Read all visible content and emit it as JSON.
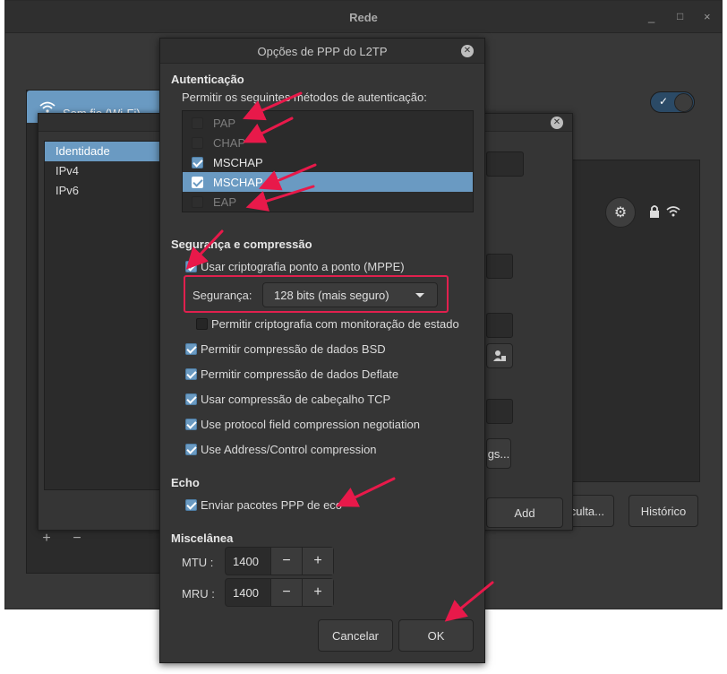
{
  "background_window": {
    "title": "Rede",
    "minimize": "_",
    "close": "×",
    "wifi_item": "Sem fio (Wi-Fi)",
    "hidden_network_button": "r a uma rede oculta...",
    "history_button": "Histórico"
  },
  "editor": {
    "sidebar_items": [
      "Identidade",
      "IPv4",
      "IPv6"
    ],
    "add_button": "Add",
    "settings_button": "gs...",
    "plus": "+",
    "minus": "−"
  },
  "dialog": {
    "title": "Opções de PPP do L2TP",
    "authentication": {
      "heading": "Autenticação",
      "description": "Permitir os seguintes métodos de autenticação:",
      "methods": [
        {
          "label": "PAP",
          "state": "disabled"
        },
        {
          "label": "CHAP",
          "state": "disabled"
        },
        {
          "label": "MSCHAP",
          "state": "checked"
        },
        {
          "label": "MSCHAP v.2",
          "state": "checked-selected"
        },
        {
          "label": "EAP",
          "state": "disabled"
        }
      ]
    },
    "security": {
      "heading": "Segurança e compressão",
      "mppe_label": "Usar criptografia ponto a ponto (MPPE)",
      "security_label": "Segurança:",
      "security_value": "128 bits (mais seguro)",
      "stateful_label": "Permitir criptografia com monitoração de estado",
      "options": [
        "Permitir compressão de dados BSD",
        "Permitir compressão de dados Deflate",
        "Usar compressão de cabeçalho TCP",
        "Use protocol field compression negotiation",
        "Use Address/Control compression"
      ]
    },
    "echo": {
      "heading": "Echo",
      "label": "Enviar pacotes PPP de eco"
    },
    "misc": {
      "heading": "Miscelânea",
      "mtu_label": "MTU :",
      "mtu_value": "1400",
      "mru_label": "MRU :",
      "mru_value": "1400",
      "minus": "−",
      "plus": "+"
    },
    "cancel_button": "Cancelar",
    "ok_button": "OK"
  },
  "colors": {
    "accent": "#6a9ac2",
    "highlight_box": "#e0204e",
    "arrows": "#e8194a"
  }
}
